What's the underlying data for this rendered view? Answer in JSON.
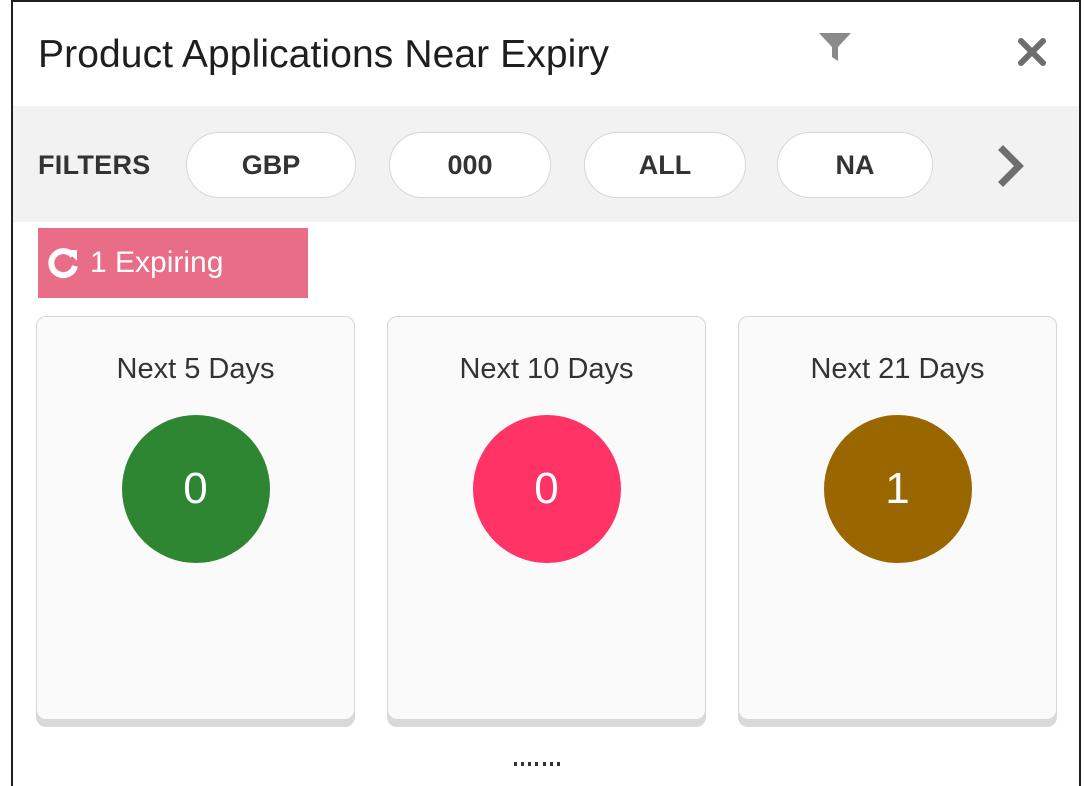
{
  "widget": {
    "title": "Product Applications Near Expiry",
    "icons": {
      "filter": "filter-icon",
      "close": "close-icon"
    }
  },
  "filters": {
    "label": "FILTERS",
    "chips": [
      "GBP",
      "000",
      "ALL",
      "NA"
    ],
    "next_icon": "chevron-right-icon"
  },
  "expiring": {
    "text": "1 Expiring",
    "icon": "refresh-icon",
    "color": "#e96d86"
  },
  "cards": [
    {
      "label": "Next 5 Days",
      "count": "0",
      "color": "#2e8532"
    },
    {
      "label": "Next 10 Days",
      "count": "0",
      "color": "#ff3366"
    },
    {
      "label": "Next 21 Days",
      "count": "1",
      "color": "#996600"
    }
  ]
}
